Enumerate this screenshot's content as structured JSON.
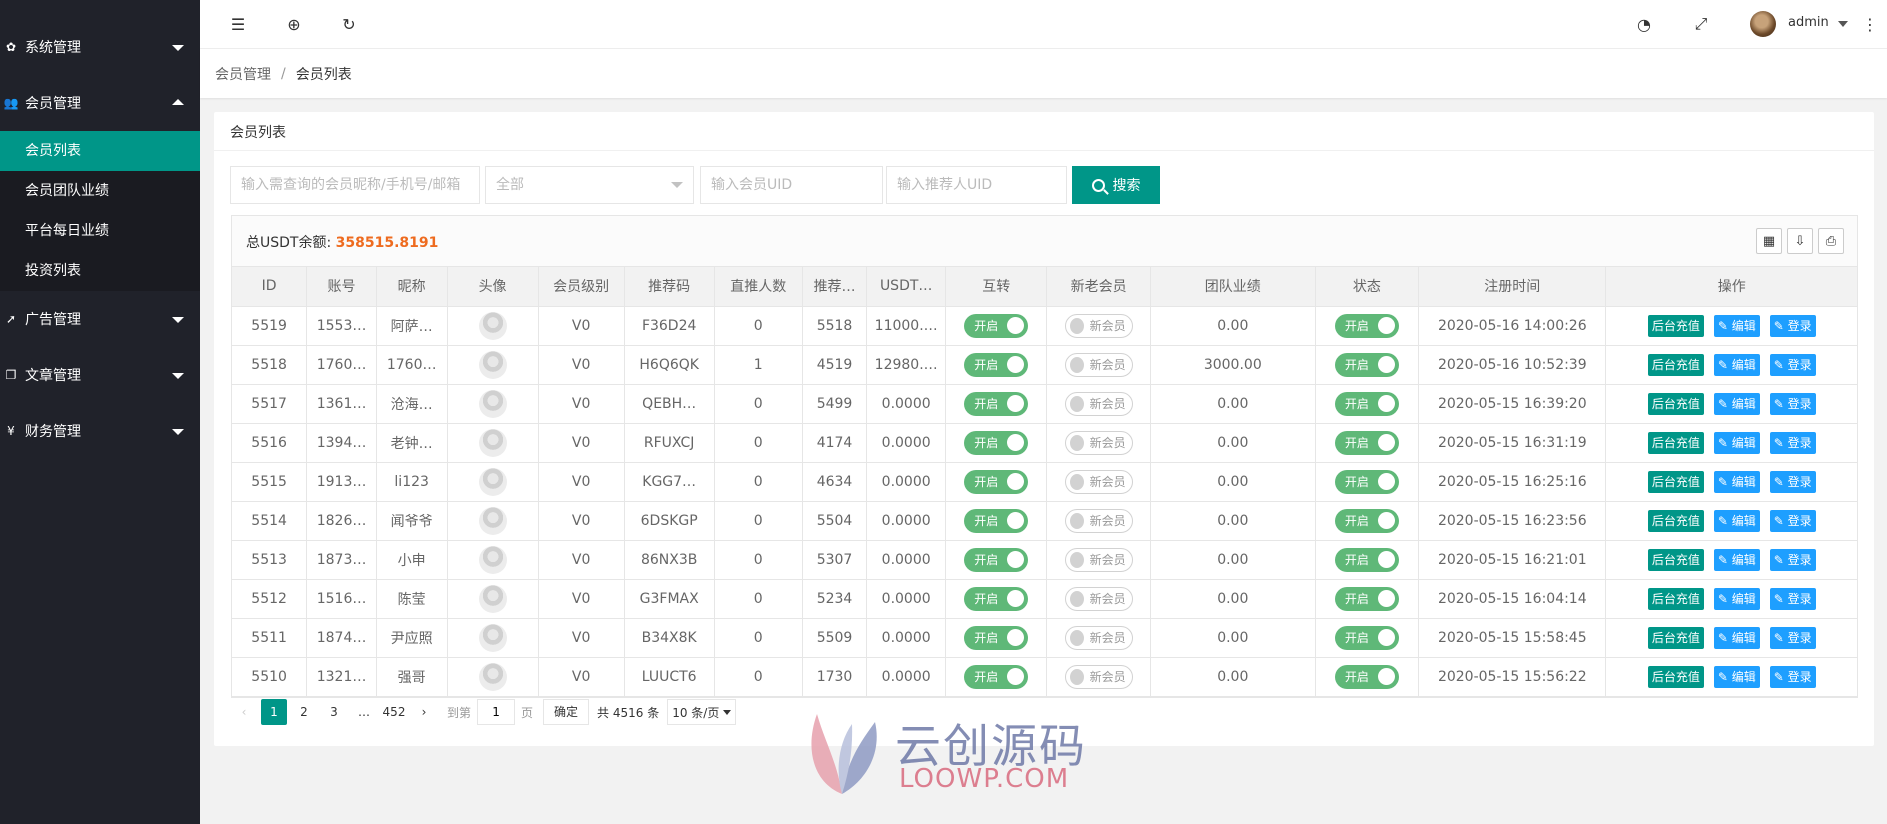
{
  "sidebar": {
    "groups": [
      {
        "label": "系统管理",
        "expanded": false
      },
      {
        "label": "会员管理",
        "expanded": true,
        "items": [
          "会员列表",
          "会员团队业绩",
          "平台每日业绩",
          "投资列表"
        ],
        "active": "会员列表"
      },
      {
        "label": "广告管理",
        "expanded": false
      },
      {
        "label": "文章管理",
        "expanded": false
      },
      {
        "label": "财务管理",
        "expanded": false
      }
    ]
  },
  "header": {
    "user": "admin",
    "icons": [
      "menu-fold-icon",
      "globe-icon",
      "refresh-icon",
      "theme-icon",
      "fullscreen-icon",
      "more-icon"
    ]
  },
  "breadcrumb": {
    "parent": "会员管理",
    "separator": "/",
    "current": "会员列表"
  },
  "card": {
    "title": "会员列表"
  },
  "filters": {
    "keyword_placeholder": "输入需查询的会员昵称/手机号/邮箱",
    "level_select": "全部",
    "uid_placeholder": "输入会员UID",
    "referrer_placeholder": "输入推荐人UID",
    "search_label": "搜索"
  },
  "summary": {
    "label": "总USDT余额:",
    "value": "358515.8191"
  },
  "table": {
    "columns": [
      "ID",
      "账号",
      "昵称",
      "头像",
      "会员级别",
      "推荐码",
      "直推人数",
      "推荐…",
      "USDT…",
      "互转",
      "新老会员",
      "团队业绩",
      "状态",
      "注册时间",
      "操作"
    ],
    "switch_on_label": "开启",
    "switch_off_label": "新会员",
    "actions": {
      "recharge": "后台充值",
      "edit": "编辑",
      "login": "登录"
    },
    "rows": [
      {
        "id": "5519",
        "account": "1553…",
        "nick": "阿萨…",
        "level": "V0",
        "code": "F36D24",
        "direct": "0",
        "ref": "5518",
        "usdt": "11000.…",
        "team": "0.00",
        "time": "2020-05-16 14:00:26"
      },
      {
        "id": "5518",
        "account": "1760…",
        "nick": "1760…",
        "level": "V0",
        "code": "H6Q6QK",
        "direct": "1",
        "ref": "4519",
        "usdt": "12980.…",
        "team": "3000.00",
        "time": "2020-05-16 10:52:39"
      },
      {
        "id": "5517",
        "account": "1361…",
        "nick": "沧海…",
        "level": "V0",
        "code": "QEBH…",
        "direct": "0",
        "ref": "5499",
        "usdt": "0.0000",
        "team": "0.00",
        "time": "2020-05-15 16:39:20"
      },
      {
        "id": "5516",
        "account": "1394…",
        "nick": "老钟…",
        "level": "V0",
        "code": "RFUXCJ",
        "direct": "0",
        "ref": "4174",
        "usdt": "0.0000",
        "team": "0.00",
        "time": "2020-05-15 16:31:19"
      },
      {
        "id": "5515",
        "account": "1913…",
        "nick": "li123",
        "level": "V0",
        "code": "KGG7…",
        "direct": "0",
        "ref": "4634",
        "usdt": "0.0000",
        "team": "0.00",
        "time": "2020-05-15 16:25:16"
      },
      {
        "id": "5514",
        "account": "1826…",
        "nick": "闻爷爷",
        "level": "V0",
        "code": "6DSKGP",
        "direct": "0",
        "ref": "5504",
        "usdt": "0.0000",
        "team": "0.00",
        "time": "2020-05-15 16:23:56"
      },
      {
        "id": "5513",
        "account": "1873…",
        "nick": "小申",
        "level": "V0",
        "code": "86NX3B",
        "direct": "0",
        "ref": "5307",
        "usdt": "0.0000",
        "team": "0.00",
        "time": "2020-05-15 16:21:01"
      },
      {
        "id": "5512",
        "account": "1516…",
        "nick": "陈莹",
        "level": "V0",
        "code": "G3FMAX",
        "direct": "0",
        "ref": "5234",
        "usdt": "0.0000",
        "team": "0.00",
        "time": "2020-05-15 16:04:14"
      },
      {
        "id": "5511",
        "account": "1874…",
        "nick": "尹应照",
        "level": "V0",
        "code": "B34X8K",
        "direct": "0",
        "ref": "5509",
        "usdt": "0.0000",
        "team": "0.00",
        "time": "2020-05-15 15:58:45"
      },
      {
        "id": "5510",
        "account": "1321…",
        "nick": "强哥",
        "level": "V0",
        "code": "LUUCT6",
        "direct": "0",
        "ref": "1730",
        "usdt": "0.0000",
        "team": "0.00",
        "time": "2020-05-15 15:56:22"
      }
    ]
  },
  "pagination": {
    "pages": [
      "1",
      "2",
      "3"
    ],
    "ellipsis": "…",
    "last": "452",
    "goto_label": "到第",
    "goto_value": "1",
    "page_unit": "页",
    "confirm": "确定",
    "total": "共 4516 条",
    "page_size": "10 条/页"
  },
  "watermark": {
    "cn": "云创源码",
    "en": "LOOWP.COM"
  },
  "colors": {
    "sidebar": "#20222a",
    "accent": "#009688",
    "switch_on": "#5fb878",
    "blue": "#1e9fff",
    "total_value": "#ee6b1f"
  }
}
